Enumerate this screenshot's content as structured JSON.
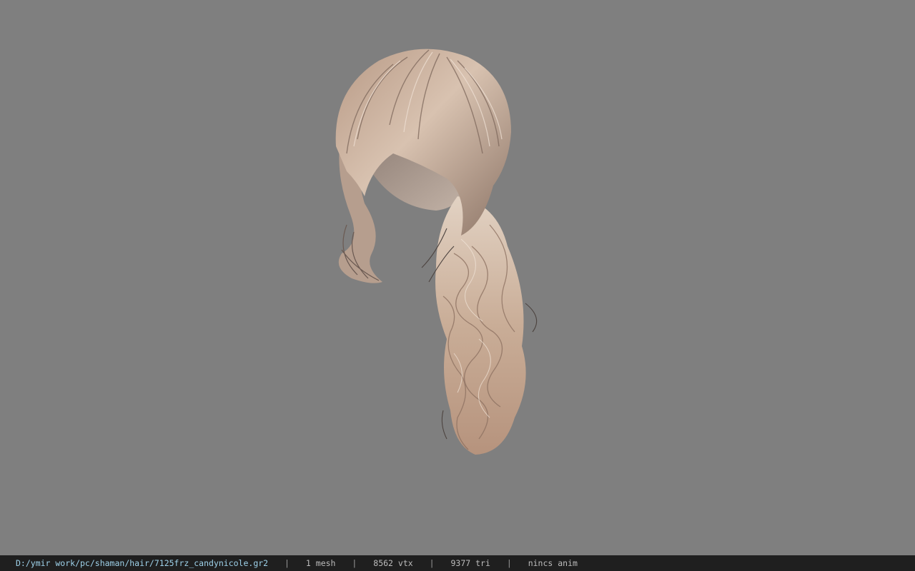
{
  "viewport": {
    "background": "#7f7f7f",
    "model": "hair-ponytail-model"
  },
  "statusbar": {
    "file_path": "D:/ymir work/pc/shaman/hair/7125frz_candynicole.gr2",
    "separator": "|",
    "mesh_count": "1 mesh",
    "vertex_count": "8562 vtx",
    "triangle_count": "9377 tri",
    "anim_status": "nincs anim",
    "path_color": "#9ed2ea"
  }
}
